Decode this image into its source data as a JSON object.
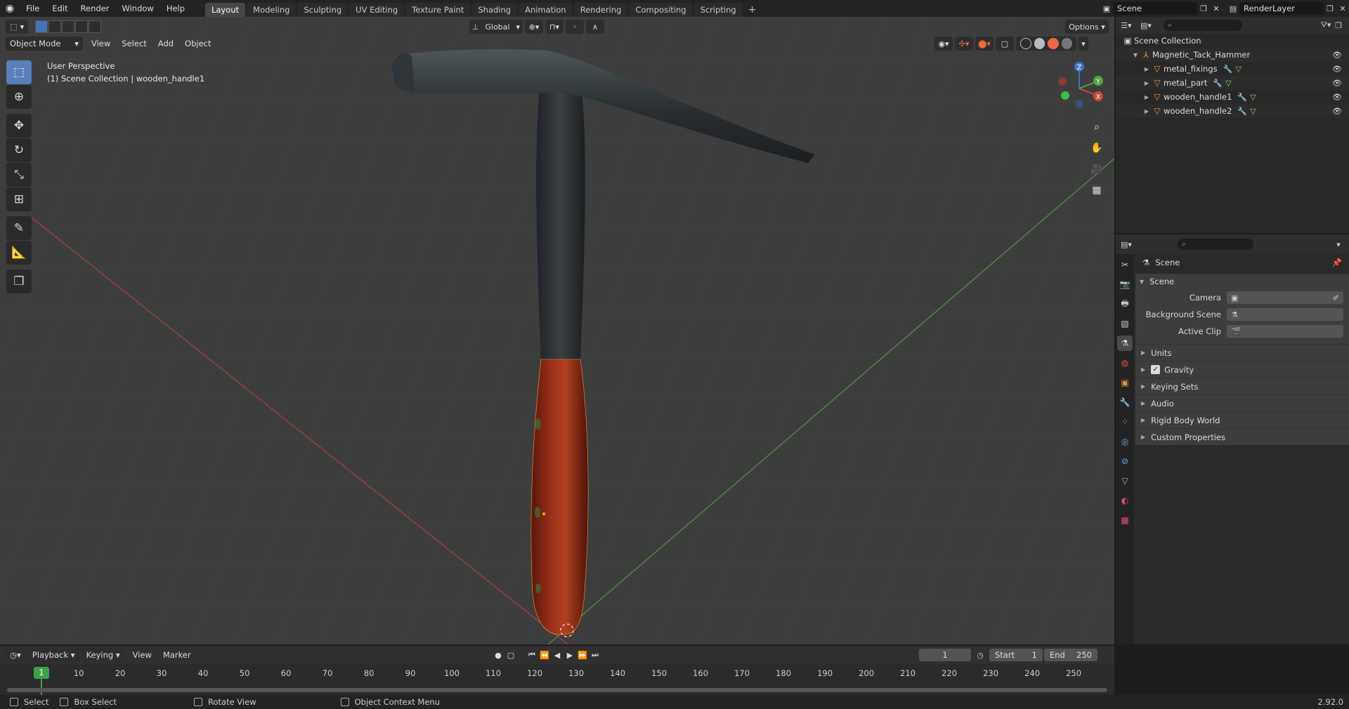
{
  "topbar": {
    "menus": [
      "File",
      "Edit",
      "Render",
      "Window",
      "Help"
    ],
    "workspaces": [
      "Layout",
      "Modeling",
      "Sculpting",
      "UV Editing",
      "Texture Paint",
      "Shading",
      "Animation",
      "Rendering",
      "Compositing",
      "Scripting"
    ],
    "active_workspace": "Layout",
    "add_tab": "+",
    "scene": "Scene",
    "view_layer": "RenderLayer"
  },
  "viewport": {
    "mode": "Object Mode",
    "menus": [
      "View",
      "Select",
      "Add",
      "Object"
    ],
    "transform_orientation": "Global",
    "options_label": "Options",
    "info_line1": "User Perspective",
    "info_line2": "(1) Scene Collection | wooden_handle1",
    "gizmo_axes": {
      "x": "X",
      "y": "Y",
      "z": "Z"
    }
  },
  "outliner": {
    "root": "Scene Collection",
    "collection": "Magnetic_Tack_Hammer",
    "objects": [
      {
        "name": "metal_fixings"
      },
      {
        "name": "metal_part"
      },
      {
        "name": "wooden_handle1"
      },
      {
        "name": "wooden_handle2"
      }
    ]
  },
  "properties": {
    "context": "Scene",
    "panel": "Scene",
    "fields": [
      {
        "label": "Camera"
      },
      {
        "label": "Background Scene"
      },
      {
        "label": "Active Clip"
      }
    ],
    "subpanels": [
      {
        "label": "Units",
        "checkbox": false
      },
      {
        "label": "Gravity",
        "checkbox": true
      },
      {
        "label": "Keying Sets",
        "checkbox": false
      },
      {
        "label": "Audio",
        "checkbox": false
      },
      {
        "label": "Rigid Body World",
        "checkbox": false
      },
      {
        "label": "Custom Properties",
        "checkbox": false
      }
    ]
  },
  "timeline": {
    "menus": [
      "Playback",
      "Keying",
      "View",
      "Marker"
    ],
    "current_frame": "1",
    "start_label": "Start",
    "start": "1",
    "end_label": "End",
    "end": "250",
    "ruler_current": "1",
    "ruler_ticks": [
      "10",
      "20",
      "30",
      "40",
      "50",
      "60",
      "70",
      "80",
      "90",
      "100",
      "110",
      "120",
      "130",
      "140",
      "150",
      "160",
      "170",
      "180",
      "190",
      "200",
      "210",
      "220",
      "230",
      "240",
      "250"
    ]
  },
  "statusbar": {
    "items": [
      "Select",
      "Box Select",
      "Rotate View",
      "Object Context Menu"
    ],
    "version": "2.92.0"
  },
  "colors": {
    "accent": "#4772b3",
    "object_icon": "#e8943a",
    "frame_marker": "#3fa04a",
    "x_axis": "#c8463e",
    "y_axis": "#56a33f",
    "z_axis": "#3f74c8"
  }
}
